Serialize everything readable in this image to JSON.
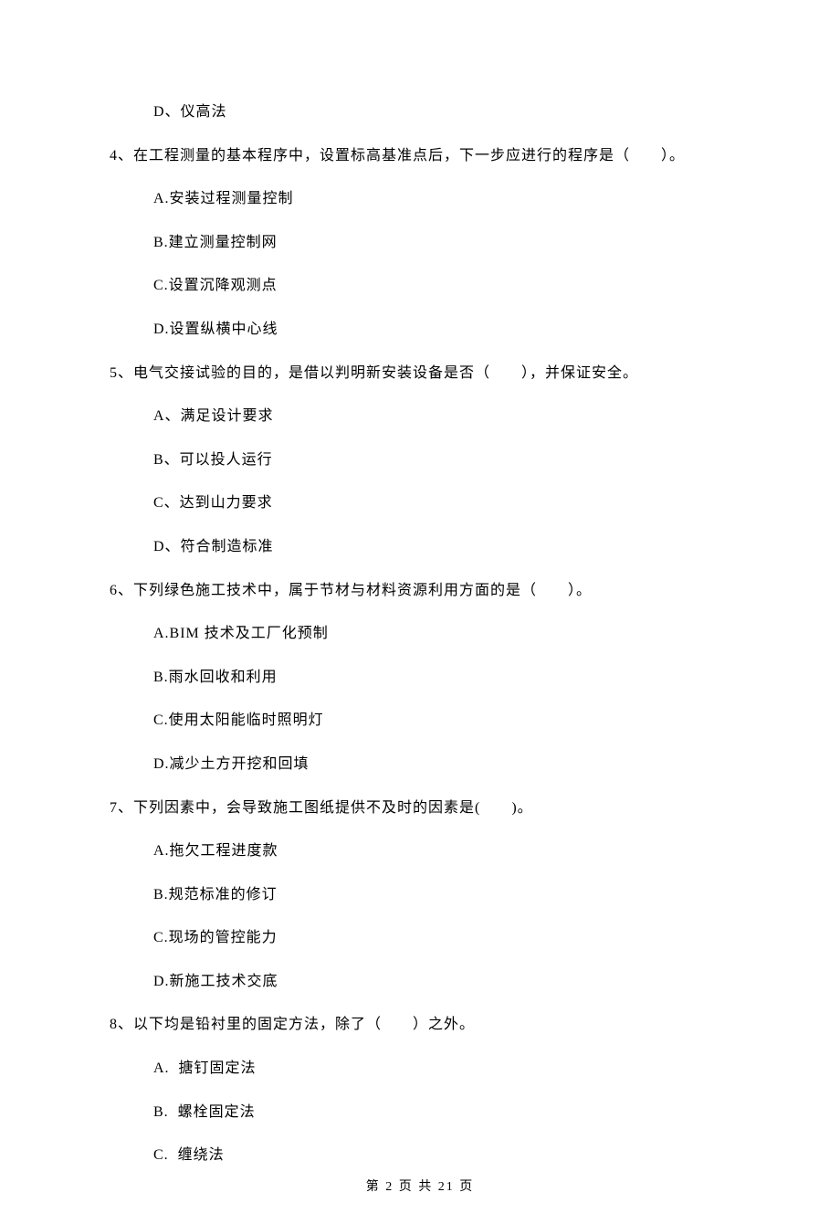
{
  "q3": {
    "options": {
      "D": "D、仪高法"
    }
  },
  "q4": {
    "stem": "4、在工程测量的基本程序中，设置标高基准点后，下一步应进行的程序是（　　）。",
    "options": {
      "A": "A.安装过程测量控制",
      "B": "B.建立测量控制网",
      "C": "C.设置沉降观测点",
      "D": "D.设置纵横中心线"
    }
  },
  "q5": {
    "stem": "5、电气交接试验的目的，是借以判明新安装设备是否（　　），并保证安全。",
    "options": {
      "A": "A、满足设计要求",
      "B": "B、可以投人运行",
      "C": "C、达到山力要求",
      "D": "D、符合制造标准"
    }
  },
  "q6": {
    "stem": "6、下列绿色施工技术中，属于节材与材料资源利用方面的是（　　）。",
    "options": {
      "A": "A.BIM 技术及工厂化预制",
      "B": "B.雨水回收和利用",
      "C": "C.使用太阳能临时照明灯",
      "D": "D.减少土方开挖和回填"
    }
  },
  "q7": {
    "stem": "7、下列因素中，会导致施工图纸提供不及时的因素是(　　)。",
    "options": {
      "A": "A.拖欠工程进度款",
      "B": "B.规范标准的修订",
      "C": "C.现场的管控能力",
      "D": "D.新施工技术交底"
    }
  },
  "q8": {
    "stem": "8、以下均是铅衬里的固定方法，除了（　　）之外。",
    "options": {
      "A": "A.  搪钉固定法",
      "B": "B.  螺栓固定法",
      "C": "C.  缠绕法"
    }
  },
  "footer": "第 2 页 共 21 页"
}
